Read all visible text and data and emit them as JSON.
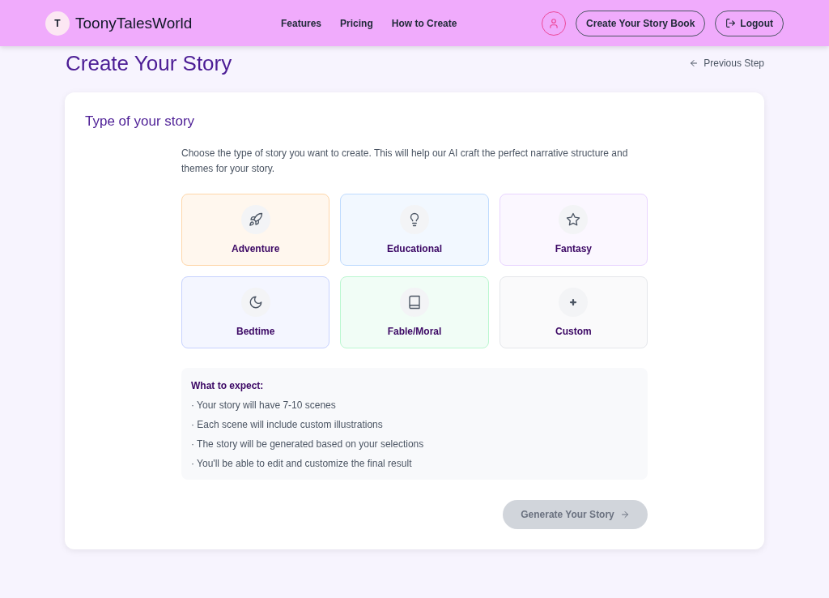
{
  "header": {
    "logo_initial": "T",
    "brand": "ToonyTalesWorld",
    "nav": [
      "Features",
      "Pricing",
      "How to Create"
    ],
    "buttons": [
      {
        "kind": "primary",
        "label": "Create Your Story Book"
      },
      {
        "kind": "logout",
        "label": "Logout"
      }
    ]
  },
  "page": {
    "title": "Create Your Story",
    "back_link": "Previous Step"
  },
  "card": {
    "title": "Type of your story",
    "description": "Choose the type of story you want to create. This will help our AI craft the perfect narrative structure and themes for your story.",
    "story_types": [
      {
        "label": "Adventure",
        "color": "#fed7aa",
        "selected": false
      },
      {
        "label": "Educational",
        "color": "#bfdbfe",
        "selected": false
      },
      {
        "label": "Fantasy",
        "color": "#e9d5ff",
        "selected": false
      },
      {
        "label": "Bedtime",
        "color": "#c7d2fe",
        "selected": false
      },
      {
        "label": "Fable/Moral",
        "color": "#bbf7d0",
        "selected": false
      },
      {
        "label": "Custom",
        "color": "#e5e7eb",
        "selected": false
      }
    ],
    "info": {
      "title": "What to expect:",
      "items": [
        "· Your story will have 7-10 scenes",
        "· Each scene will include custom illustrations",
        "· The story will be generated based on your selections",
        "· You'll be able to edit and customize the final result"
      ]
    },
    "generate_button": {
      "label": "Generate Your Story",
      "disabled": true
    }
  }
}
